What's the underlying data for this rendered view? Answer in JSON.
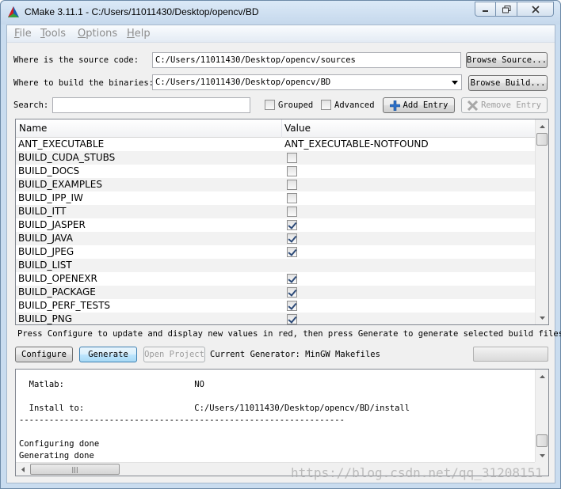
{
  "window": {
    "title": "CMake 3.11.1 - C:/Users/11011430/Desktop/opencv/BD"
  },
  "menu": [
    {
      "mnemonic": "F",
      "rest": "ile"
    },
    {
      "mnemonic": "T",
      "rest": "ools"
    },
    {
      "mnemonic": "O",
      "rest": "ptions"
    },
    {
      "mnemonic": "H",
      "rest": "elp"
    }
  ],
  "source": {
    "label": "Where is the source code:",
    "value": "C:/Users/11011430/Desktop/opencv/sources",
    "browse_label": "Browse Source..."
  },
  "build": {
    "label": "Where to build the binaries:",
    "value": "C:/Users/11011430/Desktop/opencv/BD",
    "browse_label": "Browse Build..."
  },
  "search": {
    "label": "Search:",
    "value": ""
  },
  "options": {
    "grouped_label": "Grouped",
    "grouped_checked": false,
    "advanced_label": "Advanced",
    "advanced_checked": false,
    "add_entry_label": "Add Entry",
    "remove_entry_label": "Remove Entry"
  },
  "table": {
    "col_name": "Name",
    "col_value": "Value",
    "rows": [
      {
        "name": "ANT_EXECUTABLE",
        "text": "ANT_EXECUTABLE-NOTFOUND"
      },
      {
        "name": "BUILD_CUDA_STUBS",
        "checked": false
      },
      {
        "name": "BUILD_DOCS",
        "checked": false
      },
      {
        "name": "BUILD_EXAMPLES",
        "checked": false
      },
      {
        "name": "BUILD_IPP_IW",
        "checked": false
      },
      {
        "name": "BUILD_ITT",
        "checked": false
      },
      {
        "name": "BUILD_JASPER",
        "checked": true
      },
      {
        "name": "BUILD_JAVA",
        "checked": true
      },
      {
        "name": "BUILD_JPEG",
        "checked": true
      },
      {
        "name": "BUILD_LIST",
        "text": ""
      },
      {
        "name": "BUILD_OPENEXR",
        "checked": true
      },
      {
        "name": "BUILD_PACKAGE",
        "checked": true
      },
      {
        "name": "BUILD_PERF_TESTS",
        "checked": true
      },
      {
        "name": "BUILD_PNG",
        "checked": true
      }
    ]
  },
  "status_text": "Press Configure to update and display new values in red, then press Generate to generate selected build files.",
  "actions": {
    "configure_label": "Configure",
    "generate_label": "Generate",
    "open_project_label": "Open Project",
    "generator_text": "Current Generator: MinGW Makefiles"
  },
  "output_lines": [
    "  Matlab:                          NO",
    "",
    "  Install to:                      C:/Users/11011430/Desktop/opencv/BD/install",
    "-----------------------------------------------------------------",
    "",
    "Configuring done",
    "Generating done"
  ],
  "scroll_grip": "|||",
  "watermark": "https://blog.csdn.net/qq_31208151"
}
